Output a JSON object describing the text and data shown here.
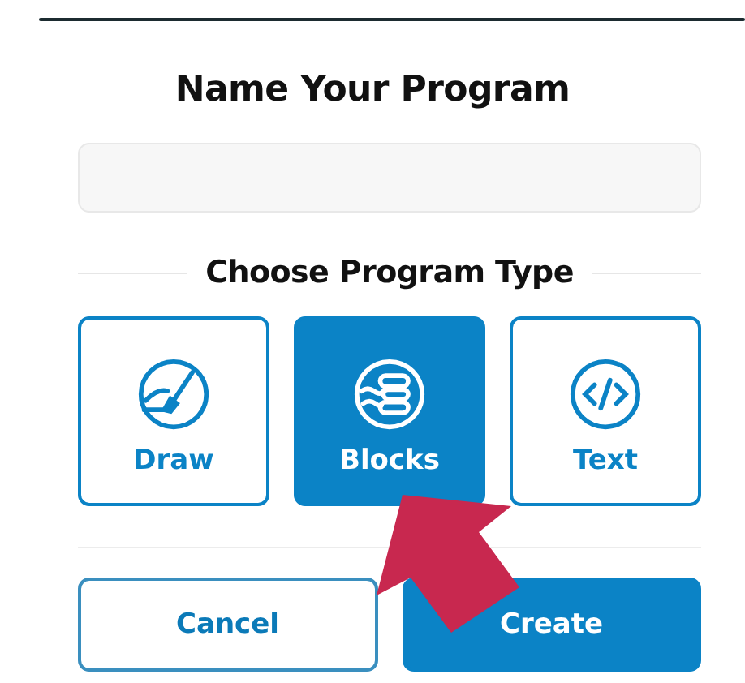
{
  "title": "Name Your Program",
  "section_heading": "Choose Program Type",
  "program_types": [
    {
      "label": "Draw",
      "kind": "draw",
      "selected": false
    },
    {
      "label": "Blocks",
      "kind": "blocks",
      "selected": true
    },
    {
      "label": "Text",
      "kind": "text",
      "selected": false
    }
  ],
  "buttons": [
    {
      "label": "Cancel",
      "kind": "secondary"
    },
    {
      "label": "Create",
      "kind": "primary"
    }
  ]
}
